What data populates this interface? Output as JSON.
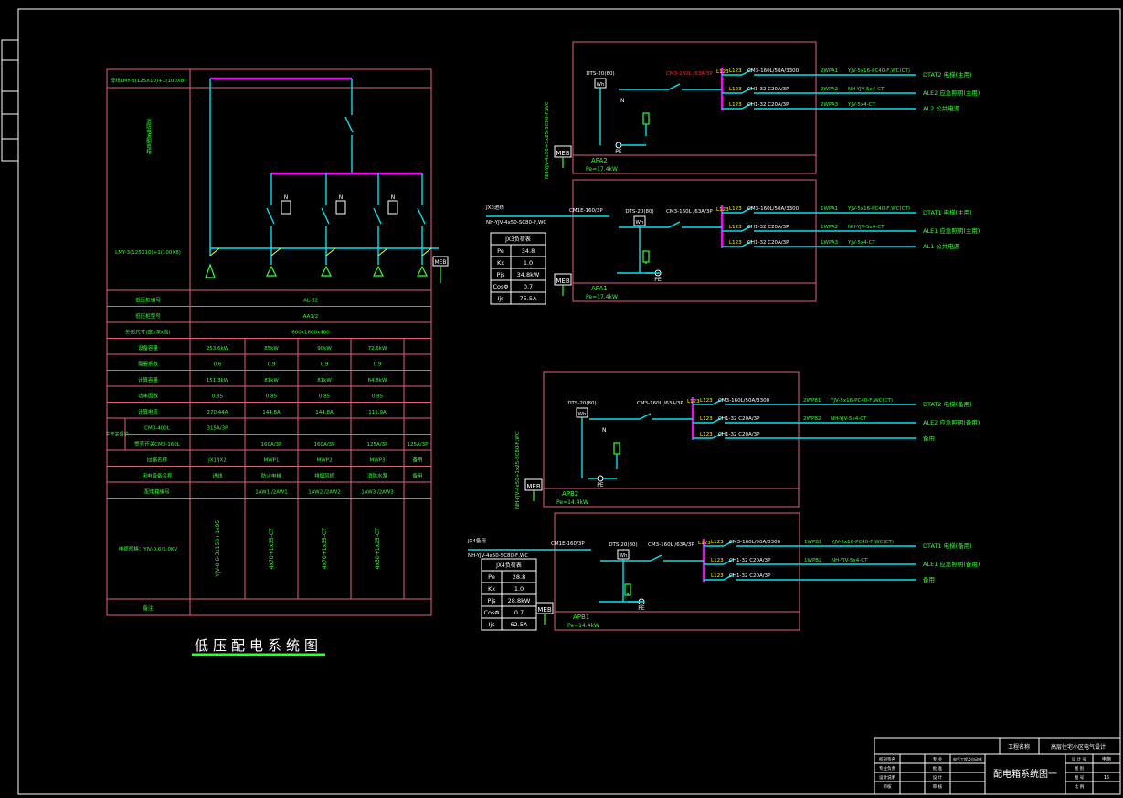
{
  "drawing": {
    "title": "低压配电系统图",
    "sheet_title": "配电箱系统图一"
  },
  "title_block": {
    "project_label": "工程名称",
    "project_name": "高层住宅小区电气设计",
    "left_labels": [
      "校对签名",
      "专业负责",
      "设计说明",
      "审核"
    ],
    "mid_labels": [
      "专 业",
      "批 准",
      "设 计",
      "审 核"
    ],
    "mid_values": [
      "电气工程及自动化",
      "",
      "",
      ""
    ],
    "right_labels": [
      "设 计 号",
      "图 别",
      "图 号",
      "比 例"
    ],
    "right_values": [
      "电施",
      "",
      "15",
      ""
    ]
  },
  "left_panel": {
    "top_model": "母线LMY-3(125X10)+1(100X8)",
    "vert_label": "消防电源配电箱",
    "bus_model": "LMY-3(125X10)+1(100X8)",
    "meter_label": "MEB",
    "rows": [
      {
        "label": "低压柜编号",
        "values": [
          "AL-S2"
        ]
      },
      {
        "label": "低压柜型号",
        "values": [
          "AA1/2"
        ]
      },
      {
        "label": "外形尺寸(宽x深x高)",
        "values": [
          "600x1800x400"
        ]
      },
      {
        "label": "设备容量",
        "values": [
          "253.6kW",
          "85kW",
          "90kW",
          "72.6kW"
        ]
      },
      {
        "label": "需要系数",
        "values": [
          "0.6",
          "0.9",
          "0.9",
          "0.9"
        ]
      },
      {
        "label": "计算容量",
        "values": [
          "151.3kW",
          "81kW",
          "81kW",
          "64.8kW"
        ]
      },
      {
        "label": "功率因数",
        "values": [
          "0.85",
          "0.85",
          "0.85",
          "0.85"
        ]
      },
      {
        "label": "计算电流",
        "values": [
          "270.44A",
          "144.8A",
          "144.8A",
          "115.9A"
        ]
      }
    ],
    "protect_label": "主开关保护",
    "breaker_rows": [
      {
        "label": "CM3-400L",
        "values": [
          "315A/3P",
          "",
          "",
          "",
          ""
        ]
      },
      {
        "label": "塑壳开关CM3-160L",
        "values": [
          "",
          "160A/3P",
          "160A/3P",
          "125A/3P",
          "125A/3P"
        ]
      }
    ],
    "circuit_row": {
      "label": "回路名称",
      "values": [
        "JX1/JX2",
        "MWP1",
        "MWP2",
        "MWP3",
        "备用"
      ]
    },
    "user_row": {
      "label": "用电设备名称",
      "values": [
        "进线",
        "防火电梯",
        "排烟风机",
        "消防水泵",
        "备用"
      ]
    },
    "panel_row": {
      "label": "配电箱编号",
      "values": [
        "",
        "1AW1 /2AW1",
        "1AW2 /2AW2",
        "1AW3 /2AW3",
        ""
      ]
    },
    "cable_label": "电缆规格：YJV-0.6/1.0KV",
    "cables": [
      "YJV-0.6-3x150+1x95",
      "4x70+1x35-CT",
      "4x70+1x35-CT",
      "4x50+1x25-CT"
    ],
    "note_label": "备注"
  },
  "boxes": {
    "APA2": {
      "name": "APA2",
      "pe": "Pe=17.4kW",
      "meter": "DTS-20(80)",
      "wh": "Wh",
      "main_breaker": "CM3-160L /63A/3P",
      "bus": "L123",
      "circuits": [
        {
          "breaker": "CM3-160L/50A/3300",
          "code": "2WPA1",
          "cable": "YJV-5x16-PC40-F,WC(CT)",
          "load": "DTAT2 电梯(主用)"
        },
        {
          "breaker": "CH1-32  C20A/3P",
          "code": "2WPA2",
          "cable": "NH-YJV-5x4-CT",
          "load": "ALE2 应急照明(主用)"
        },
        {
          "breaker": "CH1-32  C20A/3P",
          "code": "2WPA3",
          "cable": "YJV-5x4-CT",
          "load": "AL2 公共电源"
        }
      ],
      "n": "N",
      "pe_label": "PE",
      "meb": "MEB",
      "feed": "NH-YJV-4x50+1x25-SC80-F,WC"
    },
    "APA1": {
      "name": "APA1",
      "pe": "Pe=17.4kW",
      "meter": "DTS-20(80)",
      "wh": "Wh",
      "main_breaker": "CM3-160L /63A/3P",
      "bus": "L123",
      "incoming": "CM1E-160/3P",
      "feed_label": "JX3进线",
      "feed": "NH-YJV-4x50-SC80-F,WC",
      "circuits": [
        {
          "breaker": "CM3-160L/50A/3300",
          "code": "1WPA1",
          "cable": "YJV-5x16-PC40-F,WC(CT)",
          "load": "DTAT1 电梯(主用)"
        },
        {
          "breaker": "CH1-32  C20A/3P",
          "code": "1WPA2",
          "cable": "NH-YJV-5x4-CT",
          "load": "ALE1 应急照明(主用)"
        },
        {
          "breaker": "CH1-32  C20A/3P",
          "code": "1WPA3",
          "cable": "YJV-5x4-CT",
          "load": "AL1 公共电源"
        }
      ],
      "pe_label": "PE",
      "meb": "MEB"
    },
    "APB2": {
      "name": "APB2",
      "pe": "Pe=14.4kW",
      "meter": "DTS-20(80)",
      "wh": "Wh",
      "main_breaker": "CM3-160L /63A/3P",
      "bus": "L123",
      "circuits": [
        {
          "breaker": "CM3-160L/50A/3300",
          "code": "2WPB1",
          "cable": "YJV-5x16-PC40-F,WC(CT)",
          "load": "DTAT2 电梯(备用)"
        },
        {
          "breaker": "CH1-32  C20A/3P",
          "code": "2WPB2",
          "cable": "NH-YJV-5x4-CT",
          "load": "ALE2 应急照明(备用)"
        },
        {
          "breaker": "CH1-32  C20A/3P",
          "code": "",
          "cable": "",
          "load": "备用"
        }
      ],
      "n": "N",
      "pe_label": "PE",
      "meb": "MEB",
      "feed": "NH-YJV-4x50+1x25-SC80-F,WC"
    },
    "APB1": {
      "name": "APB1",
      "pe": "Pe=14.4kW",
      "meter": "DTS-20(80)",
      "wh": "Wh",
      "main_breaker": "CM3-160L /63A/3P",
      "bus": "L123",
      "incoming": "CM1E-160/3P",
      "feed_label": "JX4备用",
      "feed": "NH-YJV-4x50-SC80-F,WC",
      "circuits": [
        {
          "breaker": "CM3-160L/50A/3300",
          "code": "1WPB1",
          "cable": "YJV-5x16-PC40-F,WC(CT)",
          "load": "DTAT1 电梯(备用)"
        },
        {
          "breaker": "CH1-32  C20A/3P",
          "code": "1WPB2",
          "cable": "NH-YJV-5x4-CT",
          "load": "ALE1 应急照明(备用)"
        },
        {
          "breaker": "CH1-32  C20A/3P",
          "code": "",
          "cable": "",
          "load": "备用"
        }
      ],
      "pe_label": "PE",
      "meb": "MEB"
    }
  },
  "load_tables": {
    "JX3": {
      "title": "JX3负荷表",
      "rows": [
        [
          "Pe",
          "34.8"
        ],
        [
          "Kx",
          "1.0"
        ],
        [
          "Pjs",
          "34.8kW"
        ],
        [
          "CosΦ",
          "0.7"
        ],
        [
          "Ijs",
          "75.5A"
        ]
      ]
    },
    "JX4": {
      "title": "JX4负荷表",
      "rows": [
        [
          "Pe",
          "28.8"
        ],
        [
          "Kx",
          "1.0"
        ],
        [
          "Pjs",
          "28.8kW"
        ],
        [
          "CosΦ",
          "0.7"
        ],
        [
          "Ijs",
          "62.5A"
        ]
      ]
    }
  },
  "colors": {
    "cable": "#00e5ee",
    "bus": "#ff00ff",
    "frame": "#e0607a",
    "text": "#33ff33",
    "highlight": "#ff2a2a",
    "accent": "#ffff00"
  }
}
